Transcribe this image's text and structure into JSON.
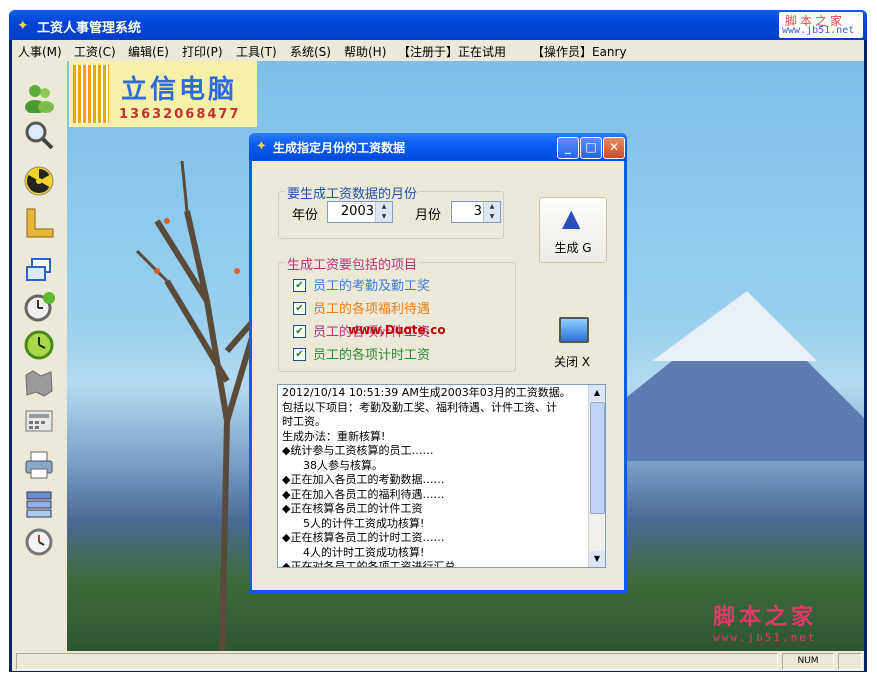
{
  "app": {
    "title": "工资人事管理系统"
  },
  "watermark_top": {
    "site_name": "脚本之家",
    "url": "www.jb51.net"
  },
  "menu": [
    {
      "label": "人事(M)"
    },
    {
      "label": "工资(C)"
    },
    {
      "label": "编辑(E)"
    },
    {
      "label": "打印(P)"
    },
    {
      "label": "工具(T)"
    },
    {
      "label": "系统(S)"
    },
    {
      "label": "帮助(H)"
    },
    {
      "label": "【注册于】正在试用"
    },
    {
      "label": "【操作员】Eanry"
    }
  ],
  "toolbar": [
    {
      "icon": "users-icon"
    },
    {
      "icon": "search-icon"
    },
    {
      "icon": "radiation-icon"
    },
    {
      "icon": "ruler-icon"
    },
    {
      "icon": "windows-icon"
    },
    {
      "icon": "clock-alert-icon"
    },
    {
      "icon": "clock-green-icon"
    },
    {
      "icon": "map-icon"
    },
    {
      "icon": "calculator-icon"
    },
    {
      "icon": "printer-icon"
    },
    {
      "icon": "items-icon"
    },
    {
      "icon": "timer-icon"
    }
  ],
  "logo": {
    "name": "立信电脑",
    "phone": "13632068477"
  },
  "watermark_bottom": {
    "site_name": "脚本之家",
    "url": "www.jb51.net"
  },
  "dialog": {
    "title": "生成指定月份的工资数据",
    "month_group": {
      "title": "要生成工资数据的月份",
      "year_label": "年份",
      "year_value": "2003",
      "month_label": "月份",
      "month_value": "3"
    },
    "items_group": {
      "title": "生成工资要包括的项目",
      "items": [
        {
          "label": "员工的考勤及勤工奖",
          "checked": true,
          "color": "#3f7fdc"
        },
        {
          "label": "员工的各项福利待遇",
          "checked": true,
          "color": "#e0801c"
        },
        {
          "label": "员工的各项计件工资",
          "checked": true,
          "color": "#b0308a"
        },
        {
          "label": "员工的各项计时工资",
          "checked": true,
          "color": "#2f8a2f"
        }
      ]
    },
    "watermark": "www.Duote.co",
    "generate_button": "生成 G",
    "close_button": "关闭 X",
    "log": [
      "2012/10/14 10:51:39 AM生成2003年03月的工资数据。",
      "包括以下项目：考勤及勤工奖、福利待遇、计件工资、计",
      "时工资。",
      "生成办法：重新核算!",
      "◆统计参与工资核算的员工……",
      "      38人参与核算。",
      "◆正在加入各员工的考勤数据……",
      "◆正在加入各员工的福利待遇……",
      "◆正在核算各员工的计件工资",
      "      5人的计件工资成功核算!",
      "◆正在核算各员工的计时工资……",
      "      4人的计时工资成功核算!",
      "◆正在对各员工的各项工资进行汇总……"
    ]
  },
  "statusbar": {
    "num": "NUM"
  }
}
